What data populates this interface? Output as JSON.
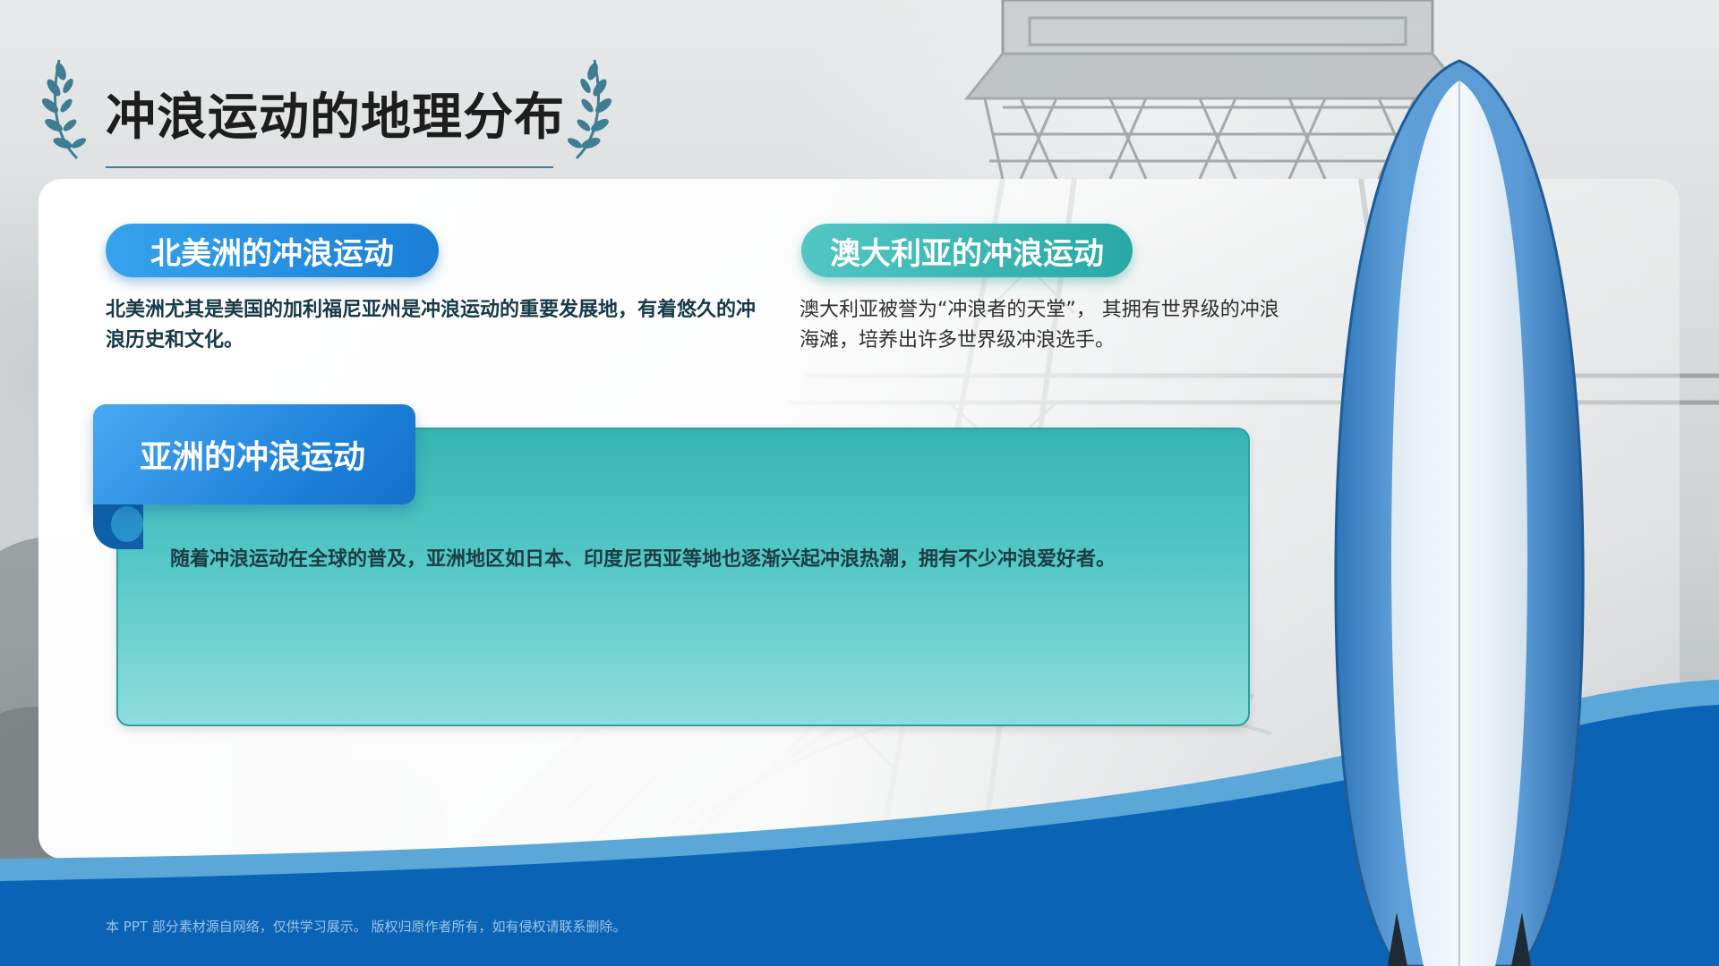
{
  "slide": {
    "title": "冲浪运动的地理分布",
    "footnote": "本 PPT 部分素材源自网络，仅供学习展示。 版权归原作者所有，如有侵权请联系删除。"
  },
  "sections": {
    "north_america": {
      "heading": "北美洲的冲浪运动",
      "text": "北美洲尤其是美国的加利福尼亚州是冲浪运动的重要发展地，有着悠久的冲浪历史和文化。"
    },
    "australia": {
      "heading": "澳大利亚的冲浪运动",
      "text": "澳大利亚被誉为“冲浪者的天堂”， 其拥有世界级的冲浪海滩，培养出许多世界级冲浪选手。"
    },
    "asia": {
      "heading": "亚洲的冲浪运动",
      "text": "随着冲浪运动在全球的普及，亚洲地区如日本、印度尼西亚等地也逐渐兴起冲浪热潮，拥有不少冲浪爱好者。"
    }
  },
  "colors": {
    "primary_blue": "#1a7fd6",
    "teal": "#27a8a6",
    "wave_blue": "#0b63b5"
  },
  "icons": [
    "laurel-icon",
    "surfboard-icon"
  ]
}
